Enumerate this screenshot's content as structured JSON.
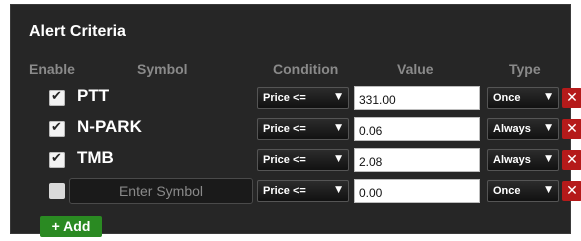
{
  "title": "Alert Criteria",
  "headers": {
    "enable": "Enable",
    "symbol": "Symbol",
    "condition": "Condition",
    "value": "Value",
    "type": "Type"
  },
  "rows": [
    {
      "enabled": true,
      "symbol": "PTT",
      "condition": "Price <=",
      "value": "331.00",
      "type": "Once"
    },
    {
      "enabled": true,
      "symbol": "N-PARK",
      "condition": "Price <=",
      "value": "0.06",
      "type": "Always"
    },
    {
      "enabled": true,
      "symbol": "TMB",
      "condition": "Price <=",
      "value": "2.08",
      "type": "Always"
    },
    {
      "enabled": false,
      "symbol": "",
      "condition": "Price <=",
      "value": "0.00",
      "type": "Once"
    }
  ],
  "new_row": {
    "symbol_placeholder": "Enter Symbol"
  },
  "add_button_label": "+ Add",
  "delete_label": "✕",
  "dropdown_arrow": "▼",
  "colors": {
    "panel_bg": "#262626",
    "header_text": "#8a8a8a",
    "delete_red": "#b51a1a",
    "add_green": "#2a8a22"
  }
}
